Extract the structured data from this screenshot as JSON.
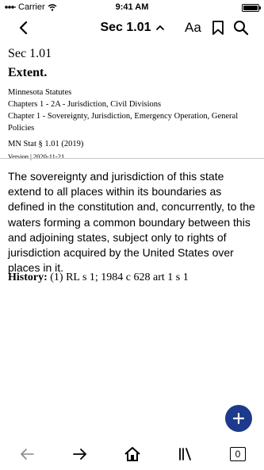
{
  "status_bar": {
    "carrier": "Carrier",
    "time": "9:41 AM"
  },
  "nav": {
    "title": "Sec 1.01",
    "font_button": "Aa"
  },
  "section": {
    "number": "Sec 1.01",
    "title": "Extent.",
    "breadcrumbs": [
      "Minnesota Statutes",
      "Chapters 1 - 2A - Jurisdiction, Civil Divisions",
      "Chapter 1 - Sovereignty, Jurisdiction, Emergency Operation, General Policies"
    ],
    "citation": "MN Stat § 1.01 (2019)",
    "version": "Version | 2020-11-21"
  },
  "body": "The sovereignty and jurisdiction of this state extend to all places within its boundaries as defined in the constitution and, concurrently, to the waters forming a common boundary between this and adjoining states, subject only to rights of jurisdiction acquired by the United States over places in it.",
  "history": {
    "label": "History:",
    "text": " (1) RL s 1; 1984 c 628 art 1 s 1"
  },
  "toolbar": {
    "tabs_count": "0"
  },
  "colors": {
    "fab": "#1e3a8c"
  },
  "icons": [
    "wifi-icon",
    "battery-icon",
    "back-chevron-icon",
    "chevron-up-icon",
    "bookmark-icon",
    "search-icon",
    "plus-icon",
    "arrow-left-icon",
    "arrow-right-icon",
    "home-icon",
    "library-icon",
    "tabs-icon"
  ]
}
